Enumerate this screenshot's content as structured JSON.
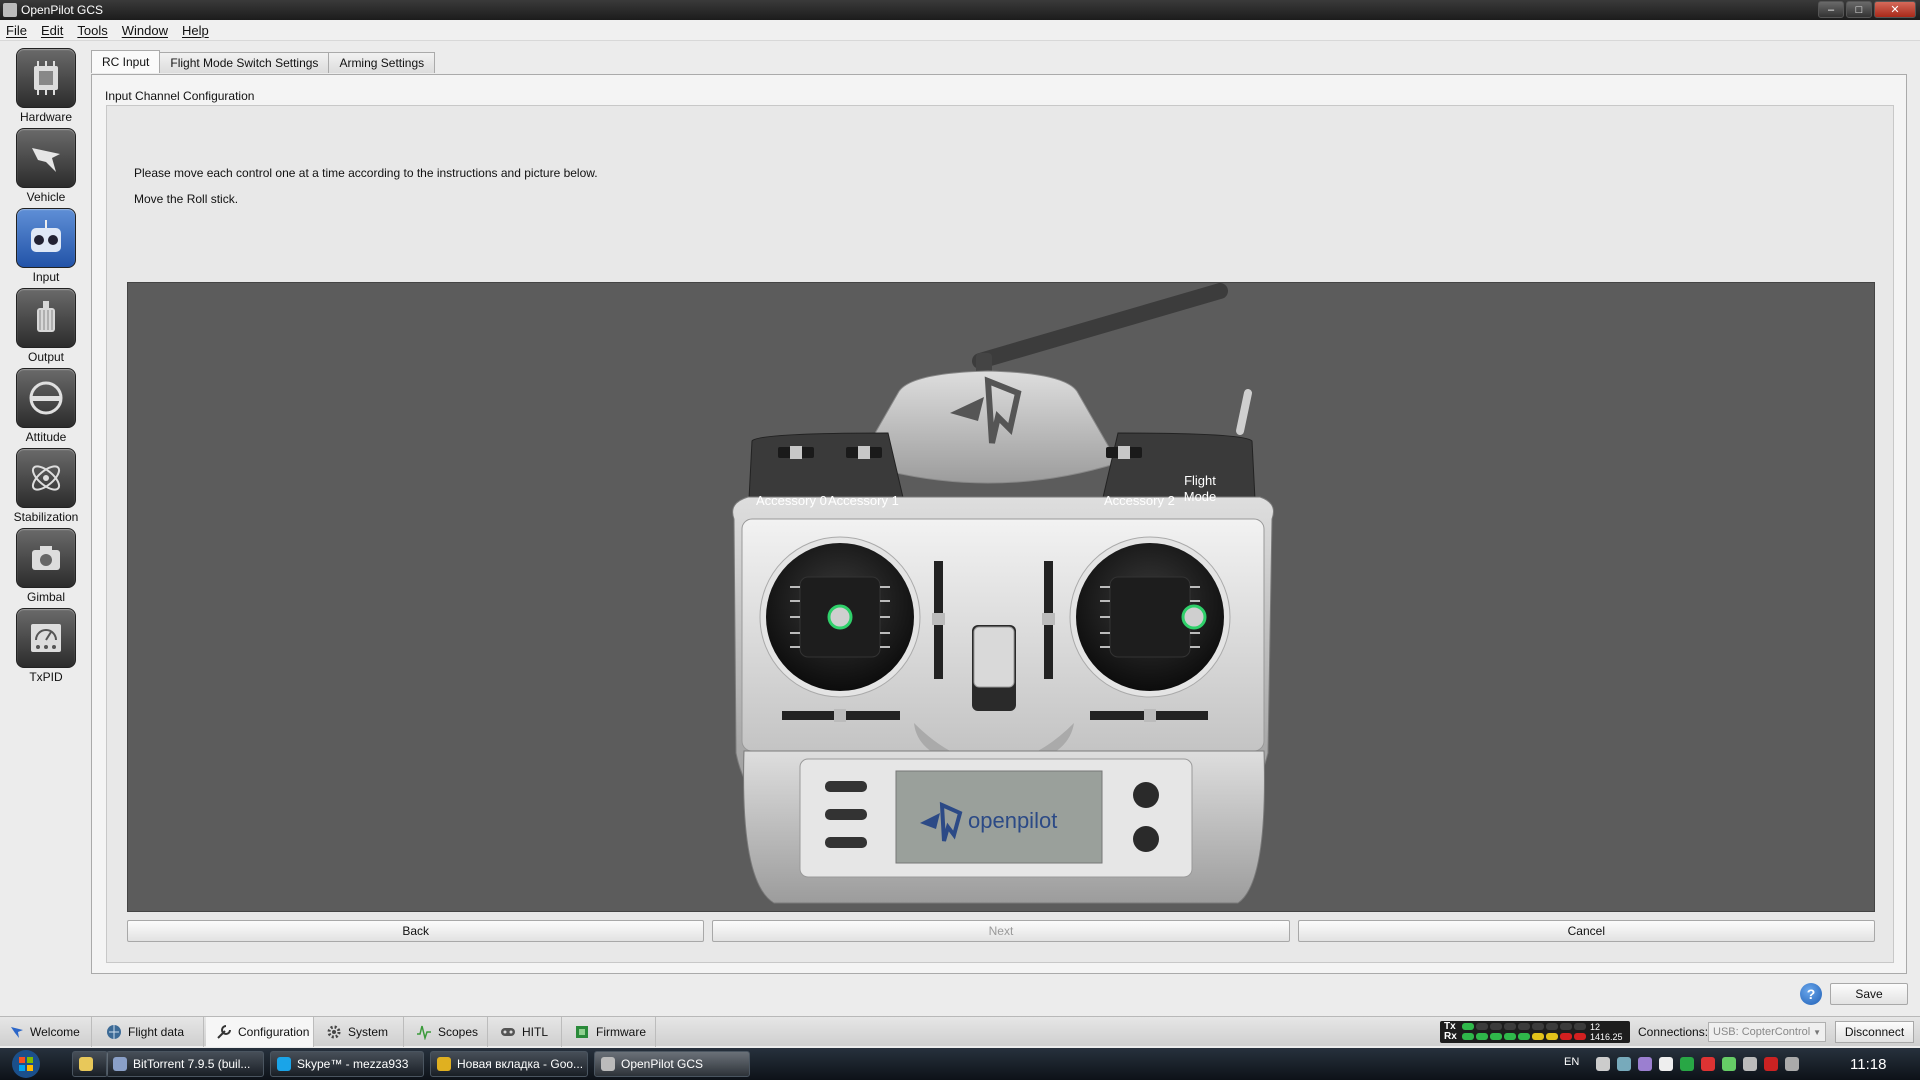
{
  "window": {
    "title": "OpenPilot GCS"
  },
  "menu": [
    "File",
    "Edit",
    "Tools",
    "Window",
    "Help"
  ],
  "sidebar": {
    "items": [
      {
        "label": "Hardware",
        "icon": "chip-icon"
      },
      {
        "label": "Vehicle",
        "icon": "airframe-icon"
      },
      {
        "label": "Input",
        "icon": "robot-transmitter-icon"
      },
      {
        "label": "Output",
        "icon": "motor-icon"
      },
      {
        "label": "Attitude",
        "icon": "level-icon"
      },
      {
        "label": "Stabilization",
        "icon": "gyro-icon"
      },
      {
        "label": "Gimbal",
        "icon": "camera-icon"
      },
      {
        "label": "TxPID",
        "icon": "meter-icon"
      }
    ],
    "active": "Input"
  },
  "tabs": [
    {
      "label": "RC Input",
      "active": true
    },
    {
      "label": "Flight Mode Switch Settings",
      "active": false
    },
    {
      "label": "Arming Settings",
      "active": false
    }
  ],
  "config": {
    "group_title": "Input Channel Configuration",
    "instruction": "Please move each control one at a time according to the instructions and picture below.",
    "step": "Move the Roll stick.",
    "highlighted_control": "Roll stick"
  },
  "transmitter": {
    "labels": {
      "acc0": "Accessory 0",
      "acc1": "Accessory 1",
      "acc2": "Accessory 2",
      "flight_mode_1": "Flight",
      "flight_mode_2": "Mode",
      "brand": "openpilot"
    }
  },
  "buttons": {
    "back": "Back",
    "next": "Next",
    "cancel": "Cancel",
    "save": "Save",
    "help": "?"
  },
  "modes": [
    {
      "label": "Welcome",
      "icon": "welcome-icon",
      "active": false
    },
    {
      "label": "Flight data",
      "icon": "globe-icon",
      "active": false
    },
    {
      "label": "Configuration",
      "icon": "wrench-icon",
      "active": true
    },
    {
      "label": "System",
      "icon": "gears-icon",
      "active": false
    },
    {
      "label": "Scopes",
      "icon": "scope-icon",
      "active": false
    },
    {
      "label": "HITL",
      "icon": "gamepad-icon",
      "active": false
    },
    {
      "label": "Firmware",
      "icon": "chip-green-icon",
      "active": false
    }
  ],
  "telemetry": {
    "tx_label": "Tx",
    "rx_label": "Rx",
    "tx_value": "12",
    "rx_value": "1416.25"
  },
  "connection": {
    "label": "Connections:",
    "value": "USB: CopterControl",
    "disconnect": "Disconnect"
  },
  "taskbar": {
    "items": [
      {
        "label": "BitTorrent 7.9.5  (buil...",
        "active": false
      },
      {
        "label": "Skype™ - mezza933",
        "active": false
      },
      {
        "label": "Новая вкладка - Goo...",
        "active": false
      },
      {
        "label": "OpenPilot GCS",
        "active": true
      }
    ],
    "lang": "EN",
    "time": "11:18"
  },
  "colors": {
    "accent": "#2b66c8",
    "highlight_ring": "#2fd06a",
    "stage_bg": "#5c5c5c"
  }
}
